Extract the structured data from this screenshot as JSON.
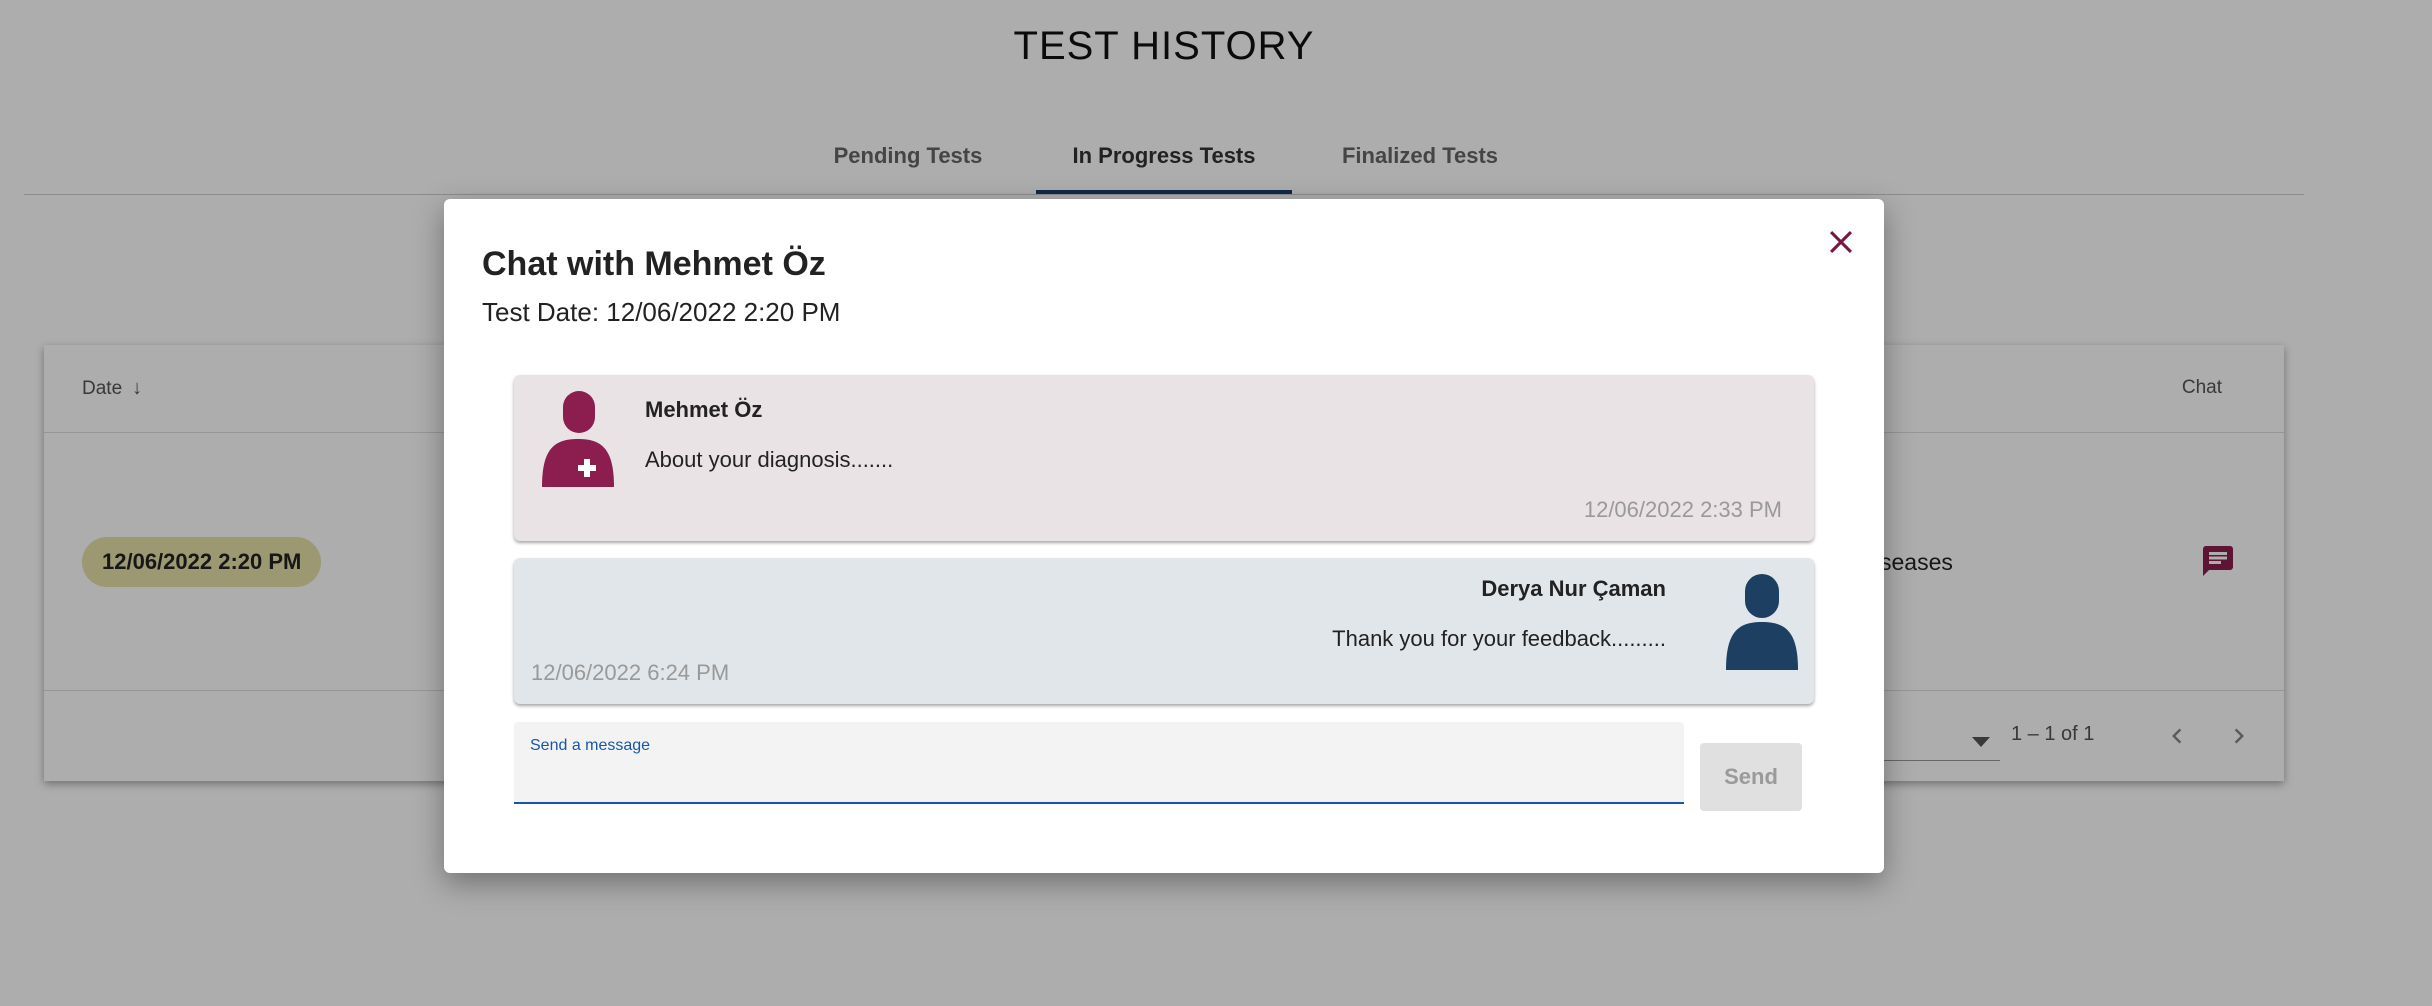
{
  "page": {
    "title": "TEST HISTORY",
    "tabs": [
      {
        "label": "Pending Tests",
        "active": false
      },
      {
        "label": "In Progress Tests",
        "active": true
      },
      {
        "label": "Finalized Tests",
        "active": false
      }
    ]
  },
  "table": {
    "headers": {
      "date": "Date",
      "chat": "Chat"
    },
    "rows": [
      {
        "date": "12/06/2022 2:20 PM",
        "partial_text": "seases"
      }
    ],
    "paginator": {
      "range_label": "1 – 1 of 1"
    }
  },
  "dialog": {
    "title": "Chat with Mehmet Öz",
    "subtitle": "Test Date: 12/06/2022 2:20 PM",
    "messages": [
      {
        "sender": "Mehmet Öz",
        "text": "About your diagnosis.......",
        "time": "12/06/2022 2:33 PM",
        "icon": "doctor-avatar-icon"
      },
      {
        "sender": "Derya Nur Çaman",
        "text": "Thank you for your feedback.........",
        "time": "12/06/2022 6:24 PM",
        "icon": "user-avatar-icon"
      }
    ],
    "input": {
      "label": "Send a message",
      "value": ""
    },
    "send_label": "Send"
  },
  "colors": {
    "accent": "#1a56a8",
    "tab_indicator": "#1a3f6e",
    "doctor_avatar": "#8b1e4f",
    "user_avatar": "#1c3f62",
    "close_icon": "#7a1540",
    "incoming_bubble": "#eae3e5",
    "outgoing_bubble": "#e1e6ea",
    "date_chip": "#e6e0a8"
  }
}
